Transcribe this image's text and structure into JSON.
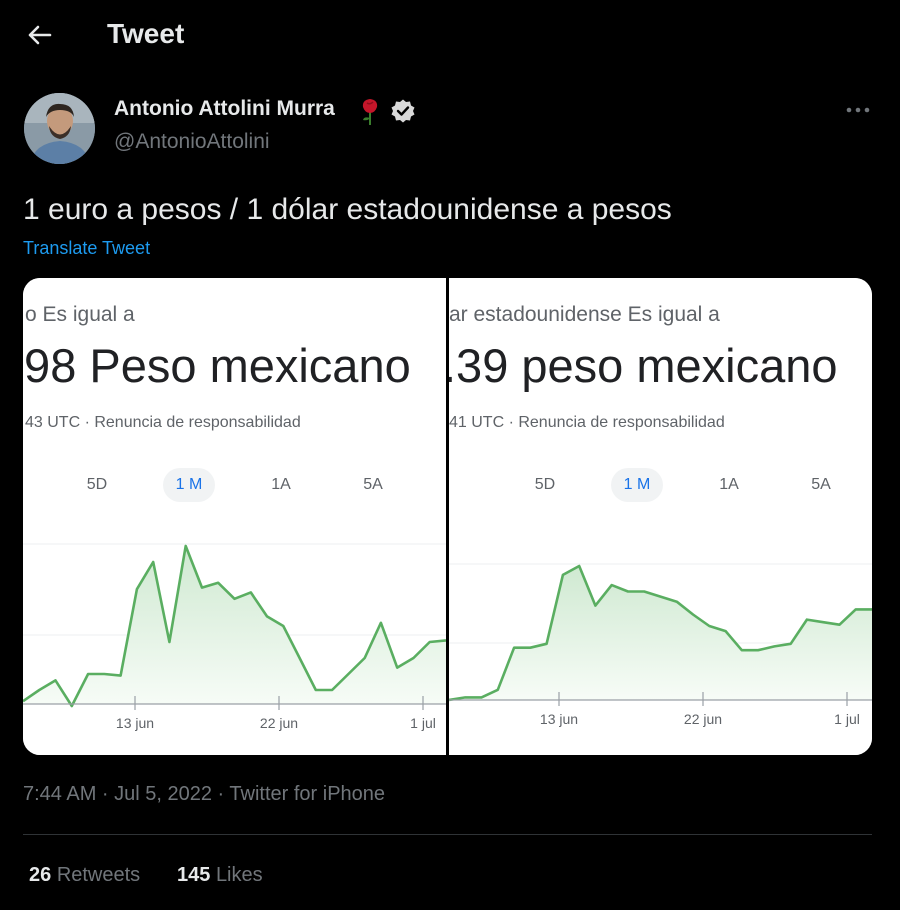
{
  "header": {
    "title": "Tweet",
    "back_icon": "arrow-left-icon"
  },
  "author": {
    "name": "Antonio Attolini Murra",
    "handle": "@AntonioAttolini",
    "emoji_icon": "rose-icon",
    "verified_icon": "verified-badge-icon"
  },
  "tweet": {
    "text": "1 euro a pesos / 1 dólar estadounidense a pesos",
    "translate_label": "Translate Tweet",
    "timestamp": "7:44 AM · Jul 5, 2022 · Twitter for iPhone"
  },
  "media": {
    "left": {
      "equal_text": "o Es igual a",
      "value_text": ".98 Peso mexicano",
      "utc_text": "43 UTC · Renuncia de responsabilidad",
      "ranges": [
        "5D",
        "1 M",
        "1A",
        "5A"
      ],
      "active_range": "1 M"
    },
    "right": {
      "equal_text": "ar estadounidense Es igual a",
      "value_text": ".39 peso mexicano",
      "utc_text": "41 UTC · Renuncia de responsabilidad",
      "ranges": [
        "5D",
        "1 M",
        "1A",
        "5A"
      ],
      "active_range": "1 M"
    }
  },
  "stats": {
    "retweets_count": "26",
    "retweets_label": "Retweets",
    "likes_count": "145",
    "likes_label": "Likes"
  },
  "colors": {
    "line": "#5aae61",
    "fill": "#e6f4e7",
    "link": "#1d9bf0",
    "active_range": "#1a73e8"
  },
  "chart_data": [
    {
      "type": "area",
      "x_tick_labels": [
        "13 jun",
        "22 jun",
        "1 jul"
      ],
      "values": [
        20.55,
        20.62,
        20.68,
        20.52,
        20.72,
        20.72,
        20.71,
        21.25,
        21.42,
        20.92,
        21.52,
        21.26,
        21.29,
        21.19,
        21.23,
        21.08,
        21.02,
        20.82,
        20.62,
        20.62,
        20.72,
        20.82,
        21.04,
        20.76,
        20.82,
        20.92,
        20.93
      ]
    },
    {
      "type": "area",
      "x_tick_labels": [
        "13 jun",
        "22 jun",
        "1 jul"
      ],
      "values": [
        19.84,
        19.86,
        19.86,
        19.92,
        20.25,
        20.25,
        20.28,
        20.82,
        20.89,
        20.58,
        20.74,
        20.69,
        20.69,
        20.65,
        20.61,
        20.51,
        20.42,
        20.38,
        20.23,
        20.23,
        20.26,
        20.28,
        20.47,
        20.45,
        20.43,
        20.55,
        20.55
      ]
    }
  ]
}
